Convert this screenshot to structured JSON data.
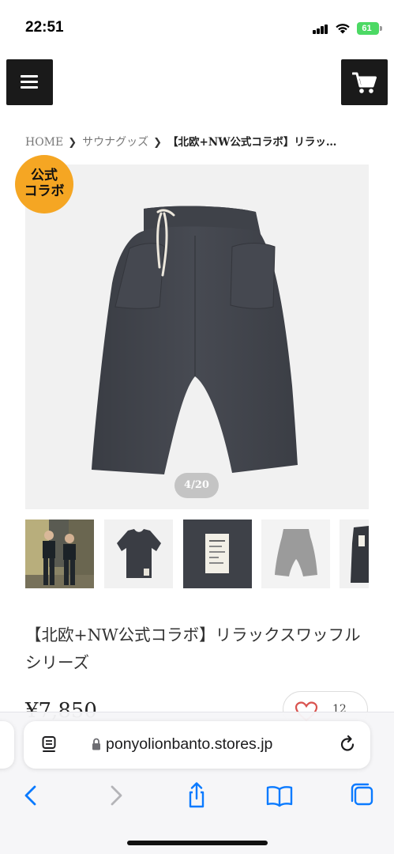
{
  "status_bar": {
    "time": "22:51",
    "battery": "61"
  },
  "header": {
    "menu_icon": "hamburger-menu-icon",
    "cart_icon": "shopping-cart-icon"
  },
  "breadcrumb": {
    "items": [
      "HOME",
      "サウナグッズ"
    ],
    "current": "【北欧+NW公式コラボ】リラッ…"
  },
  "product": {
    "badge": {
      "line1": "公式",
      "line2": "コラボ",
      "color": "#f5a623"
    },
    "image_counter": "4/20",
    "thumbnails": [
      "two-people-photo",
      "black-tshirt",
      "waffle-label-closeup",
      "gray-pants",
      "black-garment-partial"
    ],
    "title": "【北欧+NW公式コラボ】リラックスワッフルシリーズ",
    "price": "¥7,850",
    "like_count": "12"
  },
  "browser": {
    "url": "ponyolionbanto.stores.jp",
    "accent": "#0a7aff",
    "nav": [
      "back-icon",
      "forward-icon",
      "share-icon",
      "bookmarks-icon",
      "tabs-icon"
    ]
  }
}
